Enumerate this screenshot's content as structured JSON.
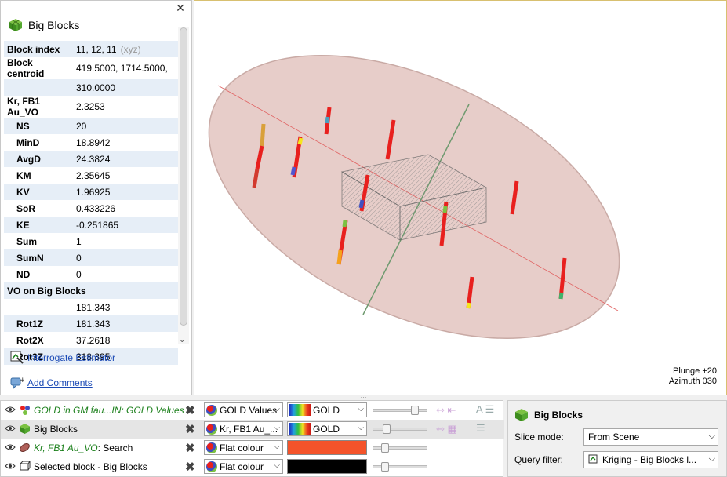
{
  "panel": {
    "title": "Big Blocks",
    "close": "✕",
    "rows": [
      {
        "key": "Block index",
        "value": "11, 12, 11",
        "suffix": "(xyz)"
      },
      {
        "key": "Block centroid",
        "value": "419.5000, 1714.5000,"
      },
      {
        "key": "",
        "value": "310.0000"
      },
      {
        "key": "Kr, FB1 Au_VO",
        "value": "2.3253"
      },
      {
        "key": "NS",
        "value": "20",
        "indent": true
      },
      {
        "key": "MinD",
        "value": "18.8942",
        "indent": true
      },
      {
        "key": "AvgD",
        "value": "24.3824",
        "indent": true
      },
      {
        "key": "KM",
        "value": "2.35645",
        "indent": true
      },
      {
        "key": "KV",
        "value": "1.96925",
        "indent": true
      },
      {
        "key": "SoR",
        "value": "0.433226",
        "indent": true
      },
      {
        "key": "KE",
        "value": "-0.251865",
        "indent": true
      },
      {
        "key": "Sum",
        "value": "1",
        "indent": true
      },
      {
        "key": "SumN",
        "value": "0",
        "indent": true
      },
      {
        "key": "ND",
        "value": "0",
        "indent": true
      },
      {
        "key": "VO on Big Blocks",
        "value": ""
      },
      {
        "key": "",
        "value": "181.343"
      },
      {
        "key": "Rot1Z",
        "value": "181.343",
        "indent": true
      },
      {
        "key": "Rot2X",
        "value": "37.2618",
        "indent": true
      },
      {
        "key": "Rot3Z",
        "value": "318.395",
        "indent": true
      }
    ],
    "link_interrogate": "Interrogate Estimator",
    "link_comments": "Add Comments"
  },
  "scene": {
    "plunge": "Plunge +20",
    "azimuth": "Azimuth 030"
  },
  "shapes": {
    "rows": [
      {
        "name": "GOLD in GM fau...IN: GOLD Values",
        "colour_mode": "GOLD Values",
        "colourmap": "GOLD",
        "italic": true
      },
      {
        "name": "Big Blocks",
        "colour_mode": "Kr, FB1 Au_...",
        "colourmap": "GOLD",
        "selected": true
      },
      {
        "name": "Kr, FB1 Au_VO: Search",
        "colour_mode": "Flat colour",
        "flat": "#f4532a",
        "italic_prefix": "Kr, FB1 Au_VO"
      },
      {
        "name": "Selected block - Big Blocks",
        "colour_mode": "Flat colour",
        "flat": "#000000"
      }
    ]
  },
  "props_panel": {
    "title": "Big Blocks",
    "slice_label": "Slice mode:",
    "slice_value": "From Scene",
    "query_label": "Query filter:",
    "query_value": "Kriging - Big Blocks l..."
  },
  "colors": {
    "ellipsoid": "#e8c9c4",
    "hole_red": "#e8201e",
    "accent_border": "#d8c070"
  }
}
